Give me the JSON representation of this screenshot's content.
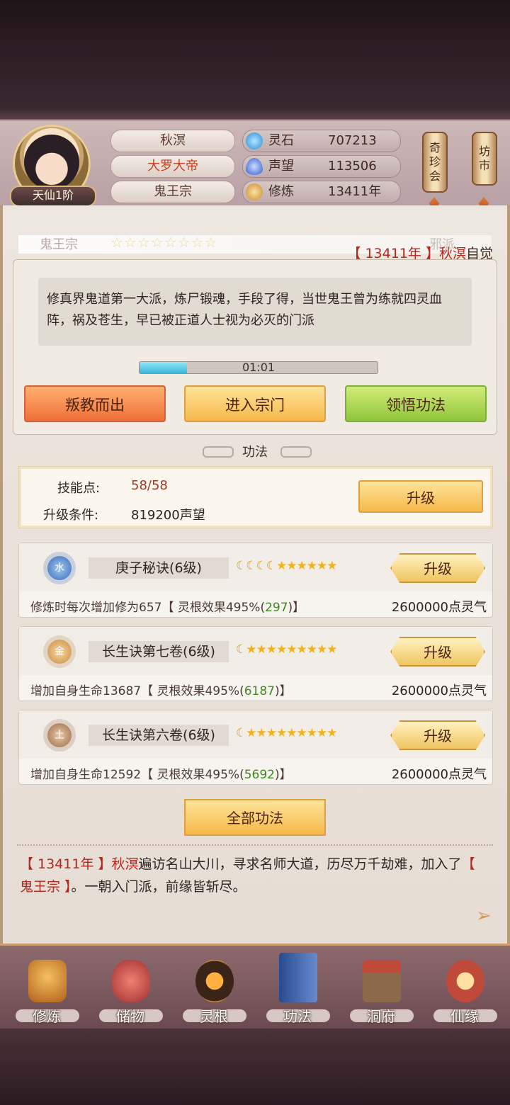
{
  "player": {
    "name": "秋溟",
    "title": "大罗大帝",
    "sect": "鬼王宗",
    "rank": "天仙1阶"
  },
  "resources": [
    {
      "icon": "spirit-stone-icon",
      "label": "灵石",
      "value": "707213",
      "color": "#3aa8e8"
    },
    {
      "icon": "reputation-crystal-icon",
      "label": "声望",
      "value": "113506",
      "color": "#4a70d8"
    },
    {
      "icon": "cultivation-figure-icon",
      "label": "修炼",
      "value": "13411年",
      "color": "#d89a40"
    }
  ],
  "side_buttons": {
    "treasure": "奇\n珍\n会",
    "market": "坊\n市"
  },
  "sect_panel": {
    "ghost_left": "鬼王宗",
    "ghost_right": "邪派",
    "event_year": "13411年",
    "event_name": "秋溟",
    "event_suffix": "自觉",
    "event_open": "【 ",
    "event_close": " 】",
    "description": "修真界鬼道第一大派，炼尸锻魂，手段了得，当世鬼王曾为练就四灵血阵，祸及苍生，早已被正道人士视为必灭的门派",
    "timer": "01:01",
    "timer_progress": 0.2,
    "btn_betray": "叛教而出",
    "btn_enter": "进入宗门",
    "btn_learn": "领悟功法"
  },
  "section_title": "功法",
  "skill_points": {
    "label": "技能点:",
    "value": "58/58",
    "cond_label": "升级条件:",
    "cond_value": "819200声望",
    "upgrade": "升级"
  },
  "techniques": [
    {
      "element": "水",
      "name": "庚子秘诀(6级)",
      "moons": 4,
      "stars": 6,
      "desc_a": "修炼时每次增加修为657【 灵根效果495%(",
      "desc_b": "297",
      "desc_c": ")】",
      "cost": "2600000点灵气",
      "upgrade": "升级",
      "color": "#5a8ac8"
    },
    {
      "element": "金",
      "name": "长生诀第七卷(6级)",
      "moons": 1,
      "stars": 9,
      "desc_a": "增加自身生命13687【 灵根效果495%(",
      "desc_b": "6187",
      "desc_c": ")】",
      "cost": "2600000点灵气",
      "upgrade": "升级",
      "color": "#d8a050"
    },
    {
      "element": "土",
      "name": "长生诀第六卷(6级)",
      "moons": 1,
      "stars": 9,
      "desc_a": "增加自身生命12592【 灵根效果495%(",
      "desc_b": "5692",
      "desc_c": ")】",
      "cost": "2600000点灵气",
      "upgrade": "升级",
      "color": "#b08060"
    }
  ],
  "all_techniques": "全部功法",
  "log": {
    "year": "【 13411年 】",
    "name": "秋溟",
    "mid": "遍访名山大川，寻求名师大道，历尽万千劫难，加入了",
    "sect": "【 鬼王宗 】",
    "end": "。一朝入门派，前缘皆斩尽。"
  },
  "nav": [
    {
      "label": "修炼",
      "icon": "cultivate-icon",
      "color": "#d8882a"
    },
    {
      "label": "储物",
      "icon": "storage-bag-icon",
      "color": "#c84a4a"
    },
    {
      "label": "灵根",
      "icon": "spirit-root-icon",
      "color": "#e07a20"
    },
    {
      "label": "功法",
      "icon": "technique-book-icon",
      "color": "#4a6ab0"
    },
    {
      "label": "洞府",
      "icon": "cave-house-icon",
      "color": "#8a5a3a"
    },
    {
      "label": "仙缘",
      "icon": "immortal-fate-icon",
      "color": "#c04a3a"
    }
  ]
}
